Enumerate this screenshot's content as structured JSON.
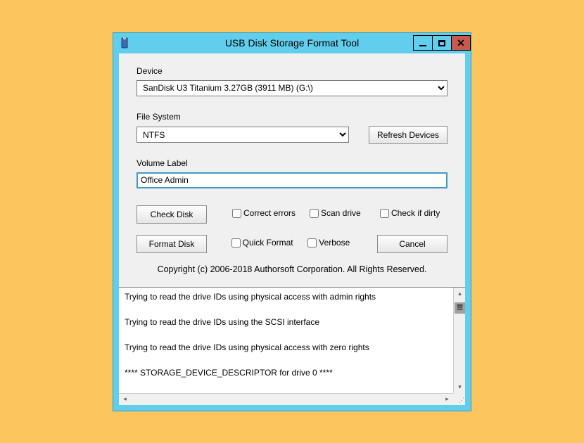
{
  "window": {
    "title": "USB Disk Storage Format Tool"
  },
  "device": {
    "label": "Device",
    "selected": "SanDisk U3 Titanium 3.27GB (3911 MB)  (G:\\)"
  },
  "filesystem": {
    "label": "File System",
    "selected": "NTFS",
    "refresh_button": "Refresh Devices"
  },
  "volume": {
    "label": "Volume Label",
    "value": "Office Admin"
  },
  "buttons": {
    "check_disk": "Check Disk",
    "format_disk": "Format Disk",
    "cancel": "Cancel"
  },
  "checkboxes": {
    "correct_errors": "Correct errors",
    "scan_drive": "Scan drive",
    "check_if_dirty": "Check if dirty",
    "quick_format": "Quick Format",
    "verbose": "Verbose"
  },
  "copyright": "Copyright (c) 2006-2018 Authorsoft Corporation. All Rights Reserved.",
  "log": {
    "lines": [
      "Trying to read the drive IDs using physical access with admin rights",
      "Trying to read the drive IDs using the SCSI interface",
      "Trying to read the drive IDs using physical access with zero rights",
      "**** STORAGE_DEVICE_DESCRIPTOR for drive 0 ****"
    ]
  }
}
